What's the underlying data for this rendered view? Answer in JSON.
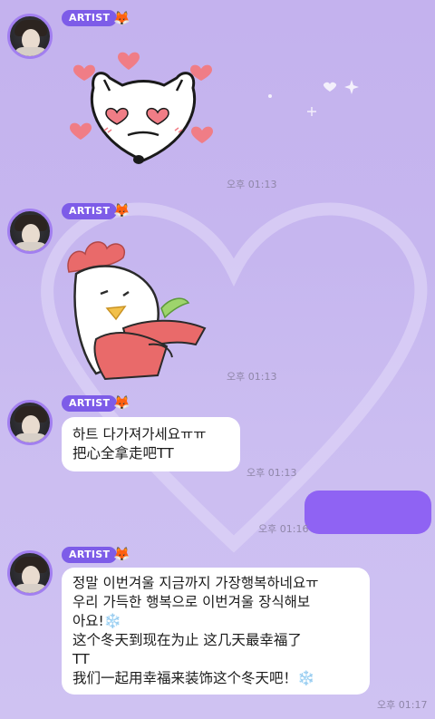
{
  "colors": {
    "badge": "#7d5ce8",
    "sent_bubble": "#8f63f3",
    "background": "#c6b6ef"
  },
  "messages": [
    {
      "avatar_icon": "profile-photo",
      "badge": "ARTIST",
      "emoji": "🦊",
      "sticker": "fox-in-love-sticker",
      "time": "오후 01:13"
    },
    {
      "avatar_icon": "profile-photo",
      "badge": "ARTIST",
      "emoji": "🦊",
      "sticker": "rooster-hugging-sticker",
      "time": "오후 01:13"
    },
    {
      "avatar_icon": "profile-photo",
      "badge": "ARTIST",
      "emoji": "🦊",
      "lines": [
        "하트 다가져가세요ㅠㅠ",
        "把心全拿走吧TT"
      ],
      "time": "오후 01:13"
    },
    {
      "outgoing": true,
      "time": "오후 01:16"
    },
    {
      "avatar_icon": "profile-photo",
      "badge": "ARTIST",
      "emoji": "🦊",
      "lines": [
        "정말 이번겨울 지금까지 가장행복하네요ㅠ",
        "우리 가득한 행복으로 이번겨울 장식해보",
        "아요!❄️",
        "这个冬天到现在为止 这几天最幸福了",
        "TT",
        "我们一起用幸福来装饰这个冬天吧！❄️"
      ],
      "time": "오후 01:17"
    }
  ]
}
